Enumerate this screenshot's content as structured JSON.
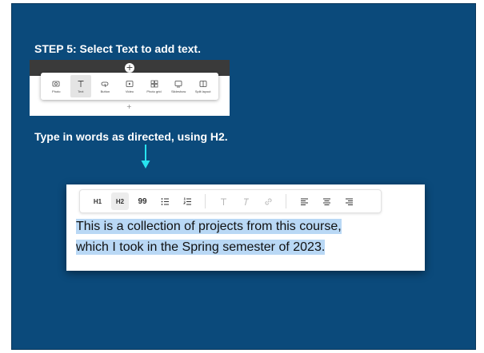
{
  "slide": {
    "title": "STEP 5: Select Text to add text.",
    "subtitle": "Type in words as directed, using H2.",
    "background_color": "#0b4a7b",
    "arrow_color": "#27e3f0"
  },
  "block_picker": {
    "top_plus": "+",
    "bottom_plus": "+",
    "options": [
      {
        "label": "Photo",
        "icon": "photo-icon"
      },
      {
        "label": "Text",
        "icon": "text-icon"
      },
      {
        "label": "Button",
        "icon": "button-icon"
      },
      {
        "label": "Video",
        "icon": "video-icon"
      },
      {
        "label": "Photo grid",
        "icon": "photo-grid-icon"
      },
      {
        "label": "Slideshow",
        "icon": "slideshow-icon"
      },
      {
        "label": "Split layout",
        "icon": "split-layout-icon"
      }
    ],
    "selected": "Text"
  },
  "editor": {
    "toolbar": {
      "h1": "H1",
      "h2": "H2",
      "quote": "99",
      "selected": "H2"
    },
    "text_line1": "This is a collection of projects from this course,",
    "text_line2": "which I took in the Spring semester of 2023.",
    "highlight_color": "#b9d8f5"
  }
}
